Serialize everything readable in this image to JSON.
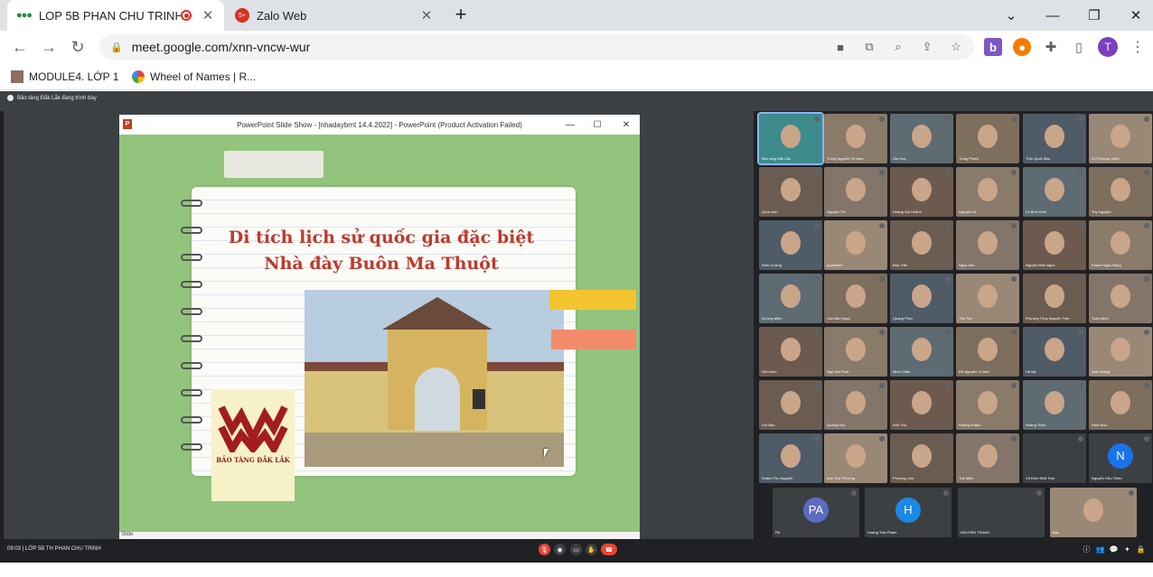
{
  "browser": {
    "tabs": [
      {
        "title": "LOP 5B PHAN CHU TRINH",
        "recording": true,
        "active": true
      },
      {
        "title": "Zalo Web",
        "active": false,
        "badge": "5+"
      }
    ],
    "new_tab": "+",
    "window_controls": [
      "⌄",
      "—",
      "❐",
      "✕"
    ],
    "url": "meet.google.com/xnn-vncw-wur",
    "profile_initial": "T",
    "bookmarks": [
      {
        "label": "MODULE4. LỚP 1"
      },
      {
        "label": "Wheel of Names | R..."
      }
    ]
  },
  "meet": {
    "presenter_label": "Bảo tàng Đắk Lắk đang trình bày",
    "meeting_info": "09:03  |  LỚP 5B TH PHAN CHU TRINH",
    "ppt_window_title": "PowerPoint Slide Show - [nhadaybmt 14.4.2022] - PowerPoint (Product Activation Failed)",
    "ppt_status": "Slide",
    "slide": {
      "title_line1": "Di tích lịch sử quốc gia đặc biệt",
      "title_line2": "Nhà đày Buôn Ma Thuột",
      "museum_name": "BẢO TÀNG ĐẮK LẮK"
    },
    "participants": [
      {
        "name": "Bảo tàng Đắk Lắk",
        "kind": "video"
      },
      {
        "name": "Trung Nguyễn Võ Nam",
        "kind": "video"
      },
      {
        "name": "Gia Huy",
        "kind": "video"
      },
      {
        "name": "Trung Phạm",
        "kind": "video"
      },
      {
        "name": "Trần Quốc Bảo",
        "kind": "video"
      },
      {
        "name": "Lê Phương Uyên",
        "kind": "video"
      },
      {
        "name": "Quốc Anh",
        "kind": "video"
      },
      {
        "name": "Nguyễn Thị",
        "kind": "video"
      },
      {
        "name": "Hoàng Gia Khánh",
        "kind": "video"
      },
      {
        "name": "Nguyễn Lê",
        "kind": "video"
      },
      {
        "name": "Lê Bình Khôi",
        "kind": "video"
      },
      {
        "name": "Thy Nguyễn",
        "kind": "video"
      },
      {
        "name": "Đinh Cường",
        "kind": "video"
      },
      {
        "name": "quynhanh",
        "kind": "video"
      },
      {
        "name": "Bảo Trân",
        "kind": "video"
      },
      {
        "name": "Ngọc Ánh",
        "kind": "video"
      },
      {
        "name": "Nguyễn Bảo Ngọc",
        "kind": "video"
      },
      {
        "name": "Khánh Ngọc Đặng",
        "kind": "video"
      },
      {
        "name": "Dương Minh",
        "kind": "video"
      },
      {
        "name": "Cao Bảo Ngọc",
        "kind": "video"
      },
      {
        "name": "Quang Phúc",
        "kind": "video"
      },
      {
        "name": "Thy Thy",
        "kind": "video"
      },
      {
        "name": "Phương Thuý Nguyễn Trần",
        "kind": "video"
      },
      {
        "name": "Tuấn Minh",
        "kind": "video"
      },
      {
        "name": "Hữu Đức",
        "kind": "video"
      },
      {
        "name": "Ngô Gia Phát",
        "kind": "video"
      },
      {
        "name": "Minh Châu",
        "kind": "video"
      },
      {
        "name": "Đỗ Nguyễn Tú Anh",
        "kind": "video"
      },
      {
        "name": "Hà My",
        "kind": "video"
      },
      {
        "name": "Anh Hoàng",
        "kind": "video"
      },
      {
        "name": "Gia Bảo",
        "kind": "video"
      },
      {
        "name": "Quang Huy",
        "kind": "video"
      },
      {
        "name": "Anh Thư",
        "kind": "video"
      },
      {
        "name": "Hoàng Khánh",
        "kind": "video"
      },
      {
        "name": "Hoàng Thảo",
        "kind": "video"
      },
      {
        "name": "Hoài Như",
        "kind": "video"
      },
      {
        "name": "Khánh Thu Nguyễn",
        "kind": "video"
      },
      {
        "name": "Anh Thư Phương",
        "kind": "video"
      },
      {
        "name": "Phương Linh",
        "kind": "video"
      },
      {
        "name": "Tuệ Minh",
        "kind": "video"
      },
      {
        "name": "Võ Đình Nhã Trân",
        "kind": "avatar",
        "initial": "",
        "color": "#3c4043"
      },
      {
        "name": "Nguyễn Hữu Thiện",
        "kind": "avatar",
        "initial": "N",
        "color": "#1a73e8"
      },
      {
        "name": "PA",
        "kind": "avatar",
        "initial": "PA",
        "color": "#5c6bc0"
      },
      {
        "name": "Hoàng Trần Phạm",
        "kind": "avatar",
        "initial": "H",
        "color": "#1e88e5"
      },
      {
        "name": "NGUYÊN TRANG",
        "kind": "avatar",
        "initial": "",
        "color": "#3c4043"
      },
      {
        "name": "Bạn",
        "kind": "video"
      }
    ]
  },
  "colors": {
    "meet_bg": "#202124",
    "end_call": "#ea4335",
    "slide_title": "#c0392b"
  }
}
